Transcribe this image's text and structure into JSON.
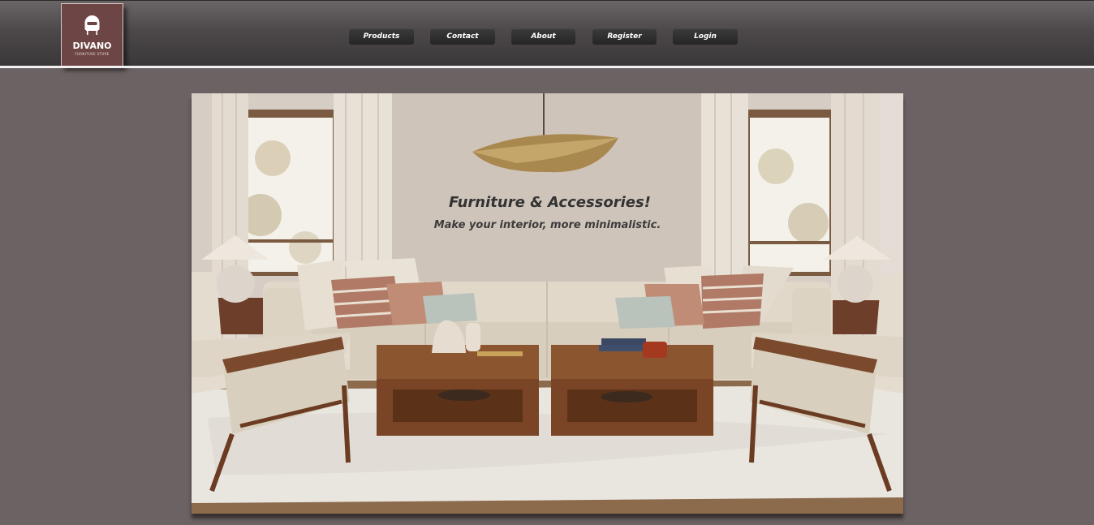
{
  "brand": {
    "name": "DIVANO",
    "tagline": "FURNITURE STORE",
    "colors": {
      "logo_bg": "#6e4545",
      "page_bg": "#6b6263",
      "nav_bg": "#2f2e2f"
    },
    "icon": "armchair-logo-icon"
  },
  "nav": {
    "items": [
      {
        "label": "Products"
      },
      {
        "label": "Contact"
      },
      {
        "label": "About"
      },
      {
        "label": "Register"
      },
      {
        "label": "Login"
      }
    ]
  },
  "hero": {
    "title": "Furniture & Accessories!",
    "subtitle": "Make your interior, more minimalistic.",
    "image_subject": "living-room-interior-photo"
  }
}
